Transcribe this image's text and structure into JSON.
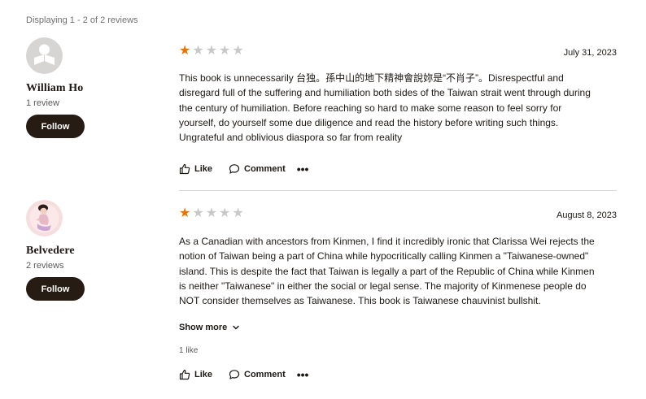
{
  "header": {
    "display_count": "Displaying 1 - 2 of 2 reviews"
  },
  "reviews": [
    {
      "reviewer": {
        "name": "William Ho",
        "review_count": "1 review",
        "follow_label": "Follow",
        "avatar": "default-reader-avatar"
      },
      "rating": 1,
      "max_rating": 5,
      "date": "July 31, 2023",
      "text_lines": [
        "This book is unnecessarily 台独。孫中山的地下精神會說妳是“不肖子”。Disrespectful and",
        "disregard full of the suffering and humiliation both sides of the Taiwan strait went through during",
        "the century of humiliation. Before reaching so hard to make some reason to feel sorry for",
        "yourself, do yourself some due diligence and read the history before writing such things.",
        "Ungrateful and oblivious diaspora so far from reality"
      ],
      "actions": {
        "like": "Like",
        "comment": "Comment",
        "more": "•••"
      }
    },
    {
      "reviewer": {
        "name": "Belvedere",
        "review_count": "2 reviews",
        "follow_label": "Follow",
        "avatar": "illustrated-portrait-avatar"
      },
      "rating": 1,
      "max_rating": 5,
      "date": "August 8, 2023",
      "text_lines": [
        "As a Canadian with ancestors from Kinmen, I find it incredibly ironic that Clarissa Wei rejects the",
        "notion of Taiwan being a part of China while hypocritically calling Kinmen a \"Taiwanese-owned\"",
        "island. This is despite the fact that Taiwan is legally a part of the Republic of China while Kinmen",
        "is neither \"Taiwanese\" in either the social or legal sense. The majority of Kinmenese people do",
        "NOT consider themselves as Taiwanese. This book is Taiwanese chauvinist bullshit."
      ],
      "show_more": "Show more",
      "likes_count": "1 like",
      "actions": {
        "like": "Like",
        "comment": "Comment",
        "more": "•••"
      }
    }
  ],
  "colors": {
    "star_filled": "#e87400",
    "star_empty": "#c8c8c8",
    "follow_bg": "#271c14"
  }
}
